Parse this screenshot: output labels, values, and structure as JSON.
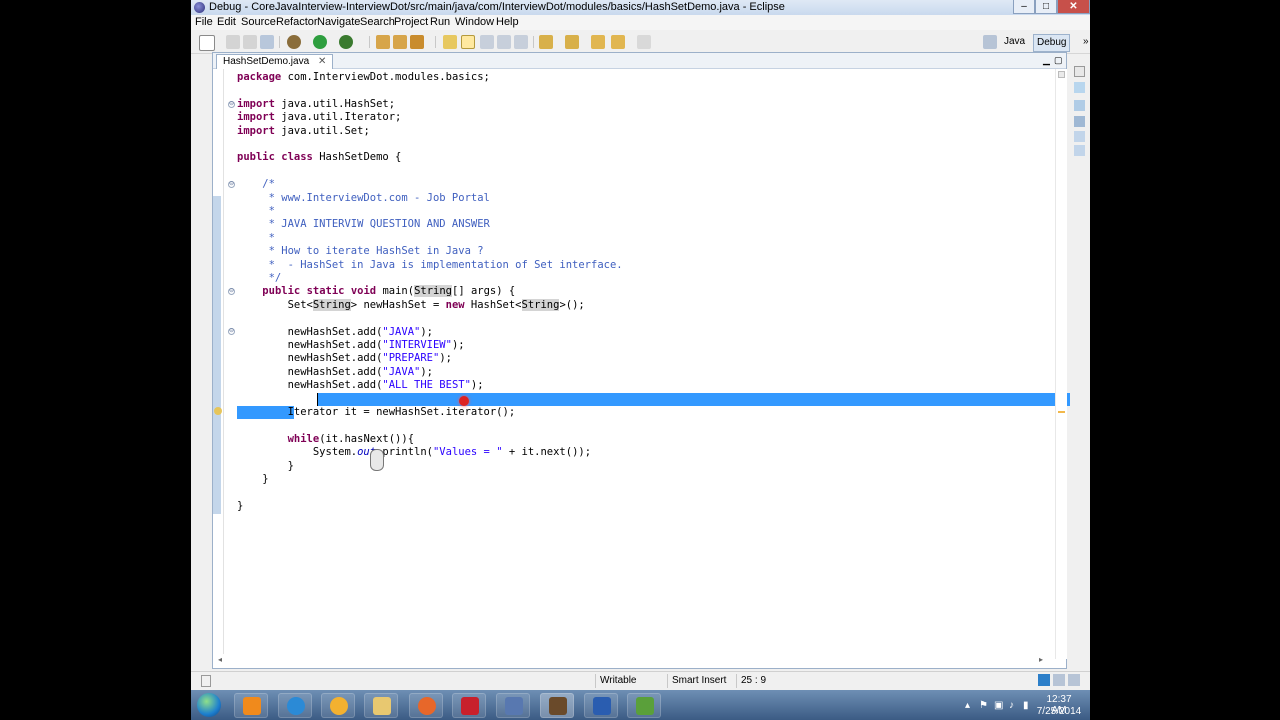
{
  "window": {
    "title": "Debug - CoreJavaInterview-InterviewDot/src/main/java/com/InterviewDot/modules/basics/HashSetDemo.java - Eclipse",
    "min_label": "–",
    "max_label": "□",
    "close_label": "✕"
  },
  "menu": [
    "File",
    "Edit",
    "Source",
    "Refactor",
    "Navigate",
    "Search",
    "Project",
    "Run",
    "Window",
    "Help"
  ],
  "perspectives": {
    "java": "Java",
    "debug": "Debug",
    "more": "»"
  },
  "editor": {
    "tab_label": "HashSetDemo.java",
    "tab_close": "✕",
    "gutter_markers": [
      "⊖",
      "⊖",
      "⊖",
      "⊖"
    ]
  },
  "code_lines": [
    "package com.InterviewDot.modules.basics;",
    "",
    "import java.util.HashSet;",
    "import java.util.Iterator;",
    "import java.util.Set;",
    "",
    "public class HashSetDemo {",
    "",
    "    /*",
    "     * www.InterviewDot.com - Job Portal",
    "     *",
    "     * JAVA INTERVIW QUESTION AND ANSWER",
    "     *",
    "     * How to iterate HashSet in Java ?",
    "     *  - HashSet in Java is implementation of Set interface.",
    "     */",
    "    public static void main(String[] args) {",
    "        Set<String> newHashSet = new HashSet<String>();",
    "",
    "        newHashSet.add(\"JAVA\");",
    "        newHashSet.add(\"INTERVIEW\");",
    "        newHashSet.add(\"PREPARE\");",
    "        newHashSet.add(\"JAVA\");",
    "        newHashSet.add(\"ALL THE BEST\");",
    "",
    "        Iterator it = newHashSet.iterator();",
    "",
    "        while(it.hasNext()){",
    "            System.out.println(\"Values = \" + it.next());",
    "        }",
    "    }",
    "",
    "}"
  ],
  "status": {
    "writable": "Writable",
    "insert_mode": "Smart Insert",
    "position": "25 : 9"
  },
  "taskbar": {
    "clock_time": "12:37 AM",
    "clock_date": "7/25/2014",
    "apps": [
      "vlc",
      "internet-explorer",
      "media-player",
      "file-explorer",
      "firefox",
      "filezilla",
      "save",
      "game",
      "word",
      "project"
    ]
  },
  "colors": {
    "keyword": "#7f0055",
    "comment": "#3f5fbf",
    "string": "#2a00ff",
    "field": "#0000c0",
    "selection": "#3399ff"
  }
}
